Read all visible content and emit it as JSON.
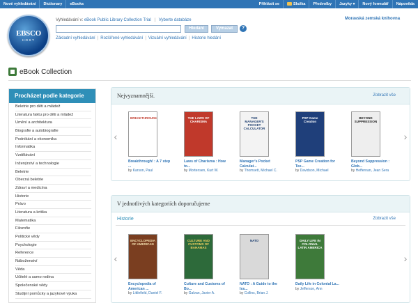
{
  "topbar": {
    "left": [
      "Nové vyhledávání",
      "Dictionary",
      "eBooks"
    ],
    "right": [
      "Přihlásit se",
      "Složka",
      "Předvolby",
      "Jazyky ▾",
      "Nový formulář",
      "Nápověda"
    ]
  },
  "header": {
    "logo_text": "EBSCO",
    "logo_sub": "HOST",
    "searching_label": "Vyhledávání v:",
    "database": "eBook Public Library Collection Trial",
    "choose_db": "Vyberte databáze",
    "search_placeholder": "",
    "search_button": "Hledání",
    "clear_button": "Vymazat",
    "help": "?",
    "links": [
      "Základní vyhledávání",
      "Rozšířené vyhledávání",
      "Vizuální vyhledávání",
      "Historie hledání"
    ],
    "library": "Moravská zemská knihovna"
  },
  "page_title": "eBook Collection",
  "sidebar": {
    "heading": "Procházet podle kategorie",
    "categories": [
      "Beletrie pro děti a mládež",
      "Literatura faktu pro děti a mládež",
      "Umění a architektura",
      "Biografie a autobiografie",
      "Podnikání a ekonomika",
      "Informatika",
      "Vzdělávání",
      "Inženýrství a technologie",
      "Beletrie",
      "Obecná beletrie",
      "Zdraví a medicína",
      "Historie",
      "Právo",
      "Literatura a kritika",
      "Matematika",
      "Filozofie",
      "Politické vědy",
      "Psychologie",
      "Reference",
      "Náboženství",
      "Věda",
      "Učitelé a samo rodina",
      "Společenské vědy",
      "Studijní pomůcky a jazykové výuka"
    ]
  },
  "panel1": {
    "title": "Nejvyznamnější.",
    "view_all": "Zobrazit vše",
    "books": [
      {
        "cover": "BREAKTHROUGH!",
        "title": "Breakthrough! : A 7 step ...",
        "by": "by",
        "author": "Karson, Paul",
        "bg": "#ffffff",
        "fg": "#c0392b"
      },
      {
        "cover": "THE LAWS OF CHARISMA",
        "title": "Laws of Charisma : How to...",
        "by": "by",
        "author": "Mortensen, Kurt W.",
        "bg": "#c0392b",
        "fg": "#ffffff"
      },
      {
        "cover": "THE MANAGER'S POCKET CALCULATOR",
        "title": "Manager's Pocket Calculat...",
        "by": "by",
        "author": "Thomsett, Michael C.",
        "bg": "#f3f3f3",
        "fg": "#1d3e6e"
      },
      {
        "cover": "PSP Game Creation",
        "title": "PSP Game Creation for Tee...",
        "by": "by",
        "author": "Davidson, Michael",
        "bg": "#1f3f7a",
        "fg": "#ffffff"
      },
      {
        "cover": "BEYOND SUPPRESSION",
        "title": "Beyond Suppression : Glob...",
        "by": "by",
        "author": "Heffernan, Jean Sera",
        "bg": "#eeeeee",
        "fg": "#222222"
      }
    ]
  },
  "panel2": {
    "title": "V jednotlivých kategoriích doporučujeme",
    "subheading": "Historie",
    "view_all": "Zobrazit vše",
    "books": [
      {
        "cover": "ENCYCLOPEDIA OF AMERICAN",
        "title": "Encyclopedia of American ...",
        "by": "by",
        "author": "Littlefield, Daniel F.",
        "bg": "#7a3e20",
        "fg": "#f5e1b0"
      },
      {
        "cover": "CULTURE AND CUSTOMS OF BAHAMAS",
        "title": "Culture and Customs of Bo...",
        "by": "by",
        "author": "Galvan, Javier A.",
        "bg": "#2d6a3a",
        "fg": "#f0d060"
      },
      {
        "cover": "NATO",
        "title": "NATO : A Guide to the Iss...",
        "by": "by",
        "author": "Collins, Brian J.",
        "bg": "#d9d9d9",
        "fg": "#1a3c6e"
      },
      {
        "cover": "DAILY LIFE IN COLONIAL LATIN AMERICA",
        "title": "Daily Life in Colonial La...",
        "by": "by",
        "author": "Jefferson, Ann",
        "bg": "#3e7a3a",
        "fg": "#ffffff"
      }
    ]
  }
}
